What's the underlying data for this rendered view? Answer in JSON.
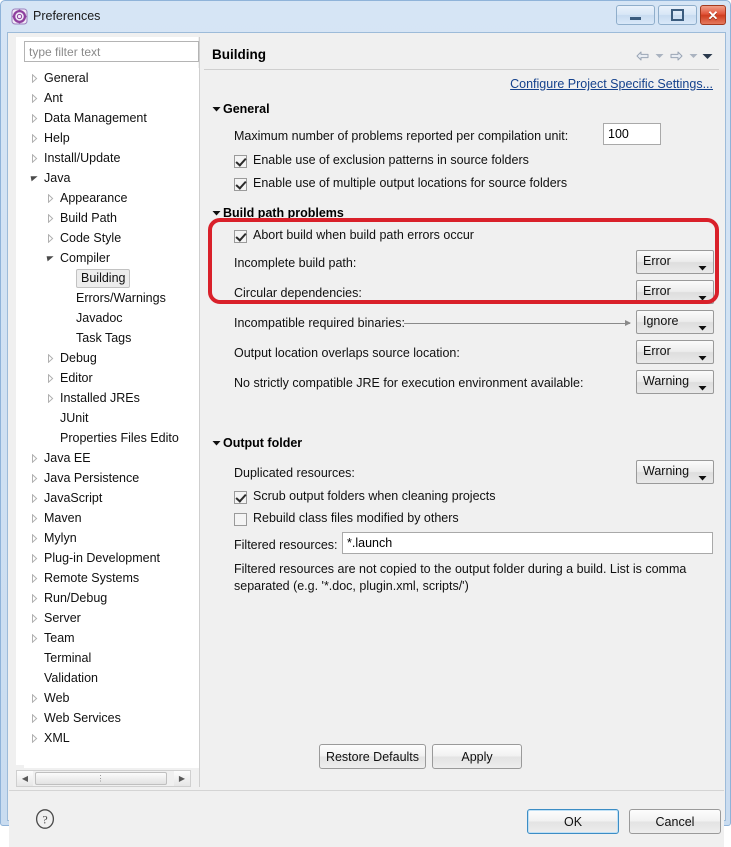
{
  "window": {
    "title": "Preferences",
    "icon": "preferences-gear-icon",
    "controls": {
      "minimize": "minimize-icon",
      "maximize": "maximize-icon",
      "close": "close-icon"
    }
  },
  "sidebar": {
    "filter": {
      "placeholder": "type filter text",
      "value": ""
    },
    "items": [
      {
        "label": "General",
        "depth": 0,
        "arrow": "collapsed",
        "selected": false
      },
      {
        "label": "Ant",
        "depth": 0,
        "arrow": "collapsed",
        "selected": false
      },
      {
        "label": "Data Management",
        "depth": 0,
        "arrow": "collapsed",
        "selected": false
      },
      {
        "label": "Help",
        "depth": 0,
        "arrow": "collapsed",
        "selected": false
      },
      {
        "label": "Install/Update",
        "depth": 0,
        "arrow": "collapsed",
        "selected": false
      },
      {
        "label": "Java",
        "depth": 0,
        "arrow": "expanded",
        "selected": false
      },
      {
        "label": "Appearance",
        "depth": 1,
        "arrow": "collapsed",
        "selected": false
      },
      {
        "label": "Build Path",
        "depth": 1,
        "arrow": "collapsed",
        "selected": false
      },
      {
        "label": "Code Style",
        "depth": 1,
        "arrow": "collapsed",
        "selected": false
      },
      {
        "label": "Compiler",
        "depth": 1,
        "arrow": "expanded",
        "selected": false
      },
      {
        "label": "Building",
        "depth": 2,
        "arrow": "none",
        "selected": true
      },
      {
        "label": "Errors/Warnings",
        "depth": 2,
        "arrow": "none",
        "selected": false
      },
      {
        "label": "Javadoc",
        "depth": 2,
        "arrow": "none",
        "selected": false
      },
      {
        "label": "Task Tags",
        "depth": 2,
        "arrow": "none",
        "selected": false
      },
      {
        "label": "Debug",
        "depth": 1,
        "arrow": "collapsed",
        "selected": false
      },
      {
        "label": "Editor",
        "depth": 1,
        "arrow": "collapsed",
        "selected": false
      },
      {
        "label": "Installed JREs",
        "depth": 1,
        "arrow": "collapsed",
        "selected": false
      },
      {
        "label": "JUnit",
        "depth": 1,
        "arrow": "none",
        "selected": false
      },
      {
        "label": "Properties Files Edito",
        "depth": 1,
        "arrow": "none",
        "selected": false
      },
      {
        "label": "Java EE",
        "depth": 0,
        "arrow": "collapsed",
        "selected": false
      },
      {
        "label": "Java Persistence",
        "depth": 0,
        "arrow": "collapsed",
        "selected": false
      },
      {
        "label": "JavaScript",
        "depth": 0,
        "arrow": "collapsed",
        "selected": false
      },
      {
        "label": "Maven",
        "depth": 0,
        "arrow": "collapsed",
        "selected": false
      },
      {
        "label": "Mylyn",
        "depth": 0,
        "arrow": "collapsed",
        "selected": false
      },
      {
        "label": "Plug-in Development",
        "depth": 0,
        "arrow": "collapsed",
        "selected": false
      },
      {
        "label": "Remote Systems",
        "depth": 0,
        "arrow": "collapsed",
        "selected": false
      },
      {
        "label": "Run/Debug",
        "depth": 0,
        "arrow": "collapsed",
        "selected": false
      },
      {
        "label": "Server",
        "depth": 0,
        "arrow": "collapsed",
        "selected": false
      },
      {
        "label": "Team",
        "depth": 0,
        "arrow": "collapsed",
        "selected": false
      },
      {
        "label": "Terminal",
        "depth": 0,
        "arrow": "none",
        "selected": false
      },
      {
        "label": "Validation",
        "depth": 0,
        "arrow": "none",
        "selected": false
      },
      {
        "label": "Web",
        "depth": 0,
        "arrow": "collapsed",
        "selected": false
      },
      {
        "label": "Web Services",
        "depth": 0,
        "arrow": "collapsed",
        "selected": false
      },
      {
        "label": "XML",
        "depth": 0,
        "arrow": "collapsed",
        "selected": false
      }
    ]
  },
  "content": {
    "page_title": "Building",
    "nav_icons": [
      "back-arrow-icon",
      "back-dropdown-icon",
      "forward-arrow-icon",
      "forward-dropdown-icon",
      "view-menu-icon"
    ],
    "configure_link": "Configure Project Specific Settings...",
    "sections": {
      "general": {
        "title": "General",
        "max_problems_label": "Maximum number of problems reported per compilation unit:",
        "max_problems_value": "100",
        "checkbox_exclusion": {
          "label": "Enable use of exclusion patterns in source folders",
          "checked": true
        },
        "checkbox_multiple_output": {
          "label": "Enable use of multiple output locations for source folders",
          "checked": true
        }
      },
      "build_path_problems": {
        "title": "Build path problems",
        "checkbox_abort": {
          "label": "Abort build when build path errors occur",
          "checked": true
        },
        "rows": [
          {
            "label": "Incomplete build path:",
            "value": "Error",
            "leader": false
          },
          {
            "label": "Circular dependencies:",
            "value": "Error",
            "leader": false
          },
          {
            "label": "Incompatible required binaries:",
            "value": "Ignore",
            "leader": true
          },
          {
            "label": "Output location overlaps source location:",
            "value": "Error",
            "leader": false
          },
          {
            "label": "No strictly compatible JRE for execution environment available:",
            "value": "Warning",
            "leader": false
          }
        ]
      },
      "output_folder": {
        "title": "Output folder",
        "duplicated_label": "Duplicated resources:",
        "duplicated_value": "Warning",
        "checkbox_scrub": {
          "label": "Scrub output folders when cleaning projects",
          "checked": true
        },
        "checkbox_rebuild": {
          "label": "Rebuild class files modified by others",
          "checked": false
        },
        "filtered_label": "Filtered resources:",
        "filtered_value": "*.launch",
        "filtered_note": "Filtered resources are not copied to the output folder during a build. List is comma separated (e.g. '*.doc, plugin.xml, scripts/')"
      }
    },
    "buttons": {
      "restore_defaults": "Restore Defaults",
      "apply": "Apply"
    }
  },
  "footer": {
    "help_icon": "help-icon",
    "ok": "OK",
    "cancel": "Cancel"
  },
  "annotation": {
    "highlight_color": "#d9202a"
  },
  "colors": {
    "link": "#14418c",
    "titlebar": "#cfe0f2",
    "panel": "#f0f0f0"
  }
}
